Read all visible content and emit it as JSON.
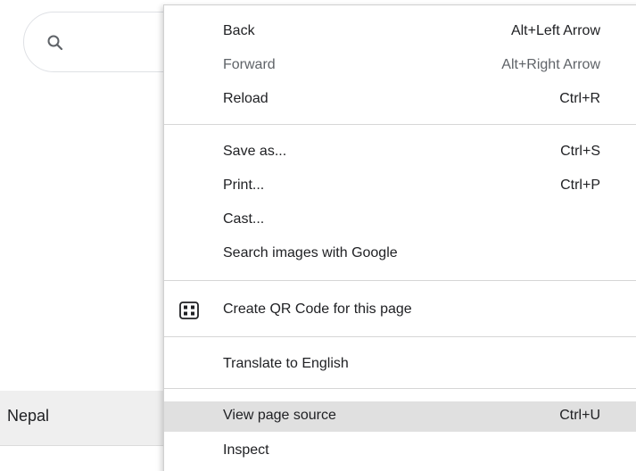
{
  "search": {
    "icon": "search-icon"
  },
  "background": {
    "country": "Nepal"
  },
  "menu": {
    "back": {
      "label": "Back",
      "shortcut": "Alt+Left Arrow"
    },
    "forward": {
      "label": "Forward",
      "shortcut": "Alt+Right Arrow"
    },
    "reload": {
      "label": "Reload",
      "shortcut": "Ctrl+R"
    },
    "save_as": {
      "label": "Save as...",
      "shortcut": "Ctrl+S"
    },
    "print": {
      "label": "Print...",
      "shortcut": "Ctrl+P"
    },
    "cast": {
      "label": "Cast..."
    },
    "search_images": {
      "label": "Search images with Google"
    },
    "qr": {
      "label": "Create QR Code for this page",
      "icon": "qr-code-icon"
    },
    "translate": {
      "label": "Translate to English"
    },
    "view_source": {
      "label": "View page source",
      "shortcut": "Ctrl+U"
    },
    "inspect": {
      "label": "Inspect"
    }
  },
  "colors": {
    "hover": "#e0e0e0",
    "text": "#202124",
    "disabled": "#5f6368",
    "separator": "#d6d6d6"
  }
}
